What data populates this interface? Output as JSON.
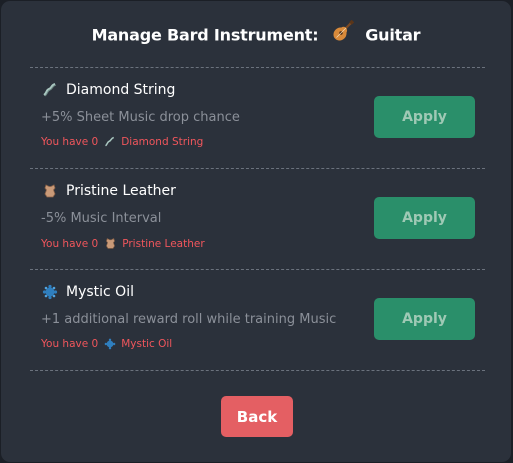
{
  "modal": {
    "title_prefix": "Manage Bard Instrument:",
    "instrument_icon": "guitar-icon",
    "instrument_name": "Guitar"
  },
  "upgrades": [
    {
      "name": "Diamond String",
      "icon": "diamond-string-icon",
      "description": "+5% Sheet Music drop chance",
      "have_prefix": "You have 0",
      "have_item": "Diamond String",
      "apply_label": "Apply"
    },
    {
      "name": "Pristine Leather",
      "icon": "pristine-leather-icon",
      "description": "-5% Music Interval",
      "have_prefix": "You have 0",
      "have_item": "Pristine Leather",
      "apply_label": "Apply"
    },
    {
      "name": "Mystic Oil",
      "icon": "mystic-oil-icon",
      "description": "+1 additional reward roll while training Music",
      "have_prefix": "You have 0",
      "have_item": "Mystic Oil",
      "apply_label": "Apply"
    }
  ],
  "back_label": "Back",
  "colors": {
    "apply_bg": "#2a8f6a",
    "back_bg": "#e45f63",
    "warning_text": "#f0565c",
    "panel_bg": "#2b313b"
  }
}
